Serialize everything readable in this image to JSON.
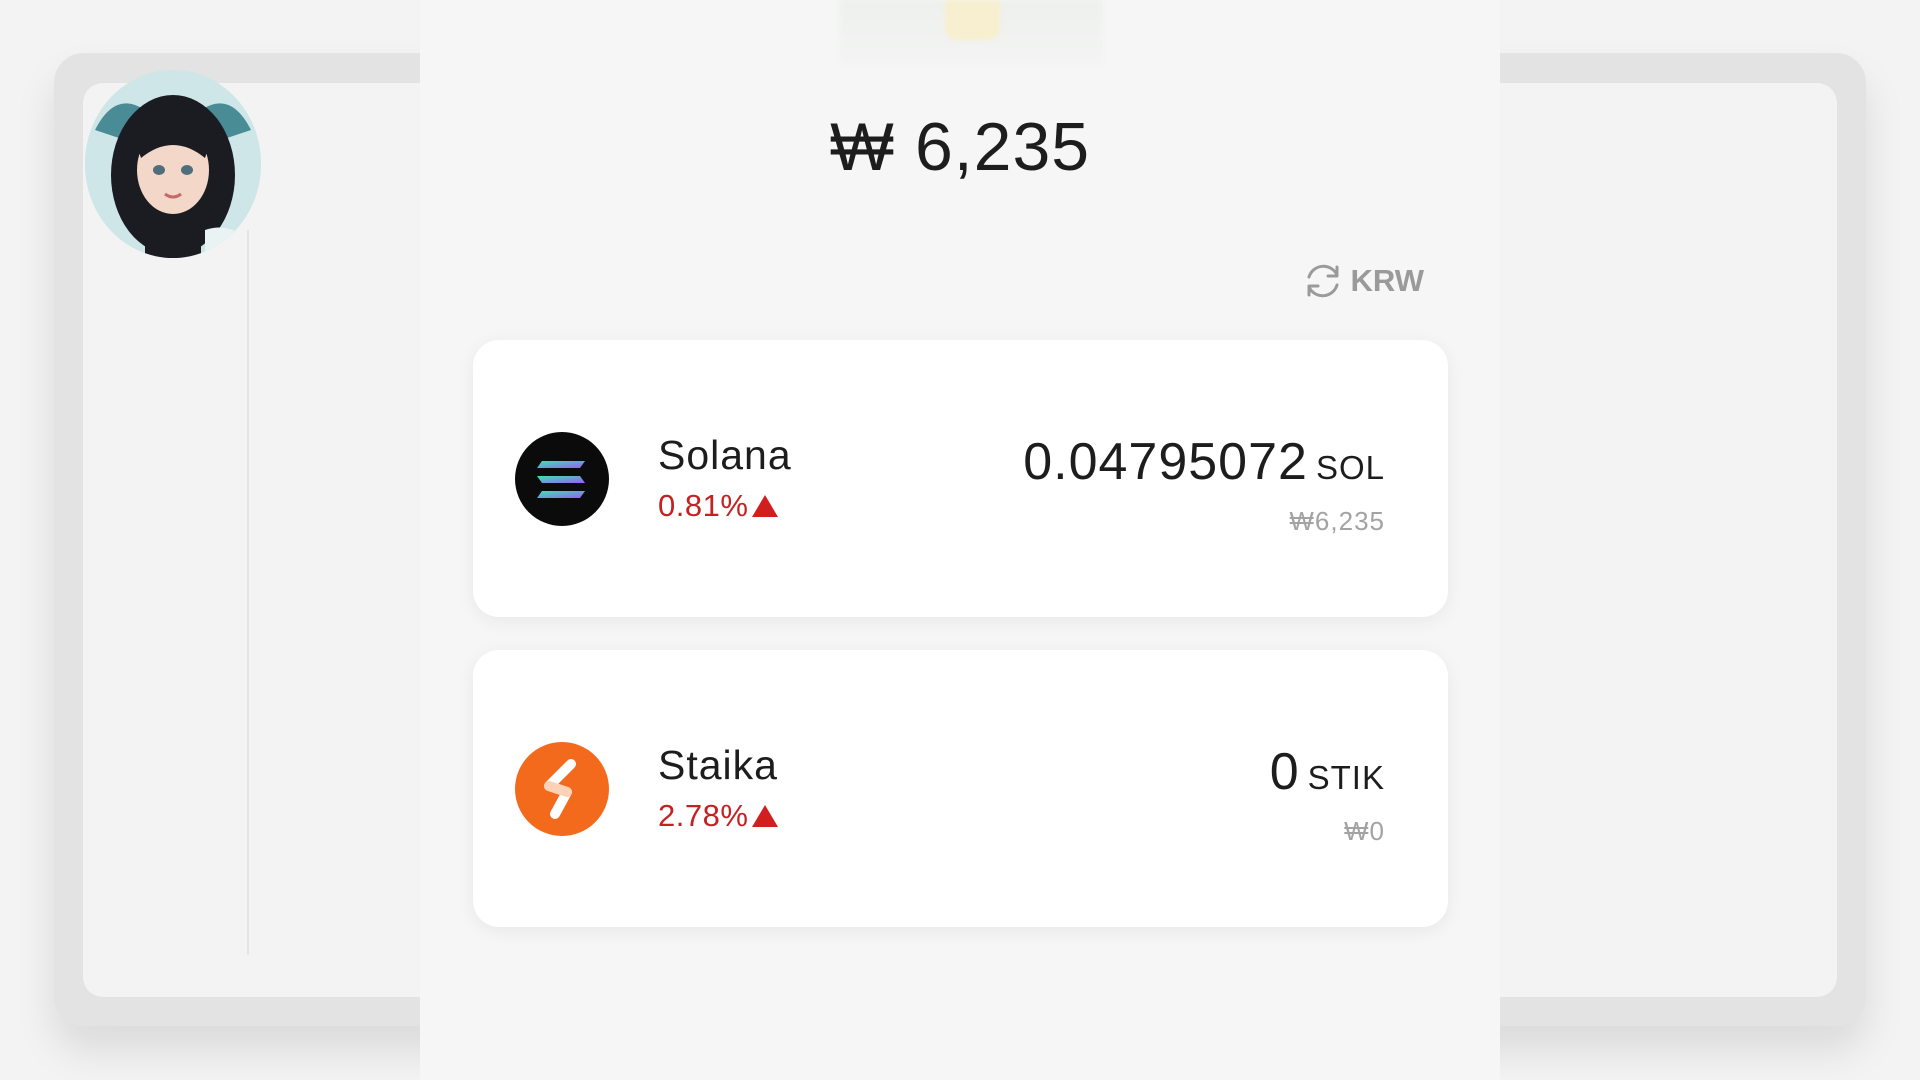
{
  "header": {
    "total_value": "₩ 6,235"
  },
  "currency_toggle": {
    "label": "KRW",
    "icon": "refresh-icon"
  },
  "assets": [
    {
      "name": "Solana",
      "change": "0.81%",
      "change_direction": "up",
      "amount": "0.04795072",
      "unit": "SOL",
      "fiat_value": "₩6,235",
      "icon": "solana-logo-icon",
      "logo_color": "#0b0b0b"
    },
    {
      "name": "Staika",
      "change": "2.78%",
      "change_direction": "up",
      "amount": "0",
      "unit": "STIK",
      "fiat_value": "₩0",
      "icon": "staika-logo-icon",
      "logo_color": "#f36a1d"
    }
  ],
  "colors": {
    "positive_change": "#c42222",
    "muted_text": "#a3a3a3",
    "card_bg": "#ffffff",
    "panel_bg": "#f5f6f5"
  }
}
